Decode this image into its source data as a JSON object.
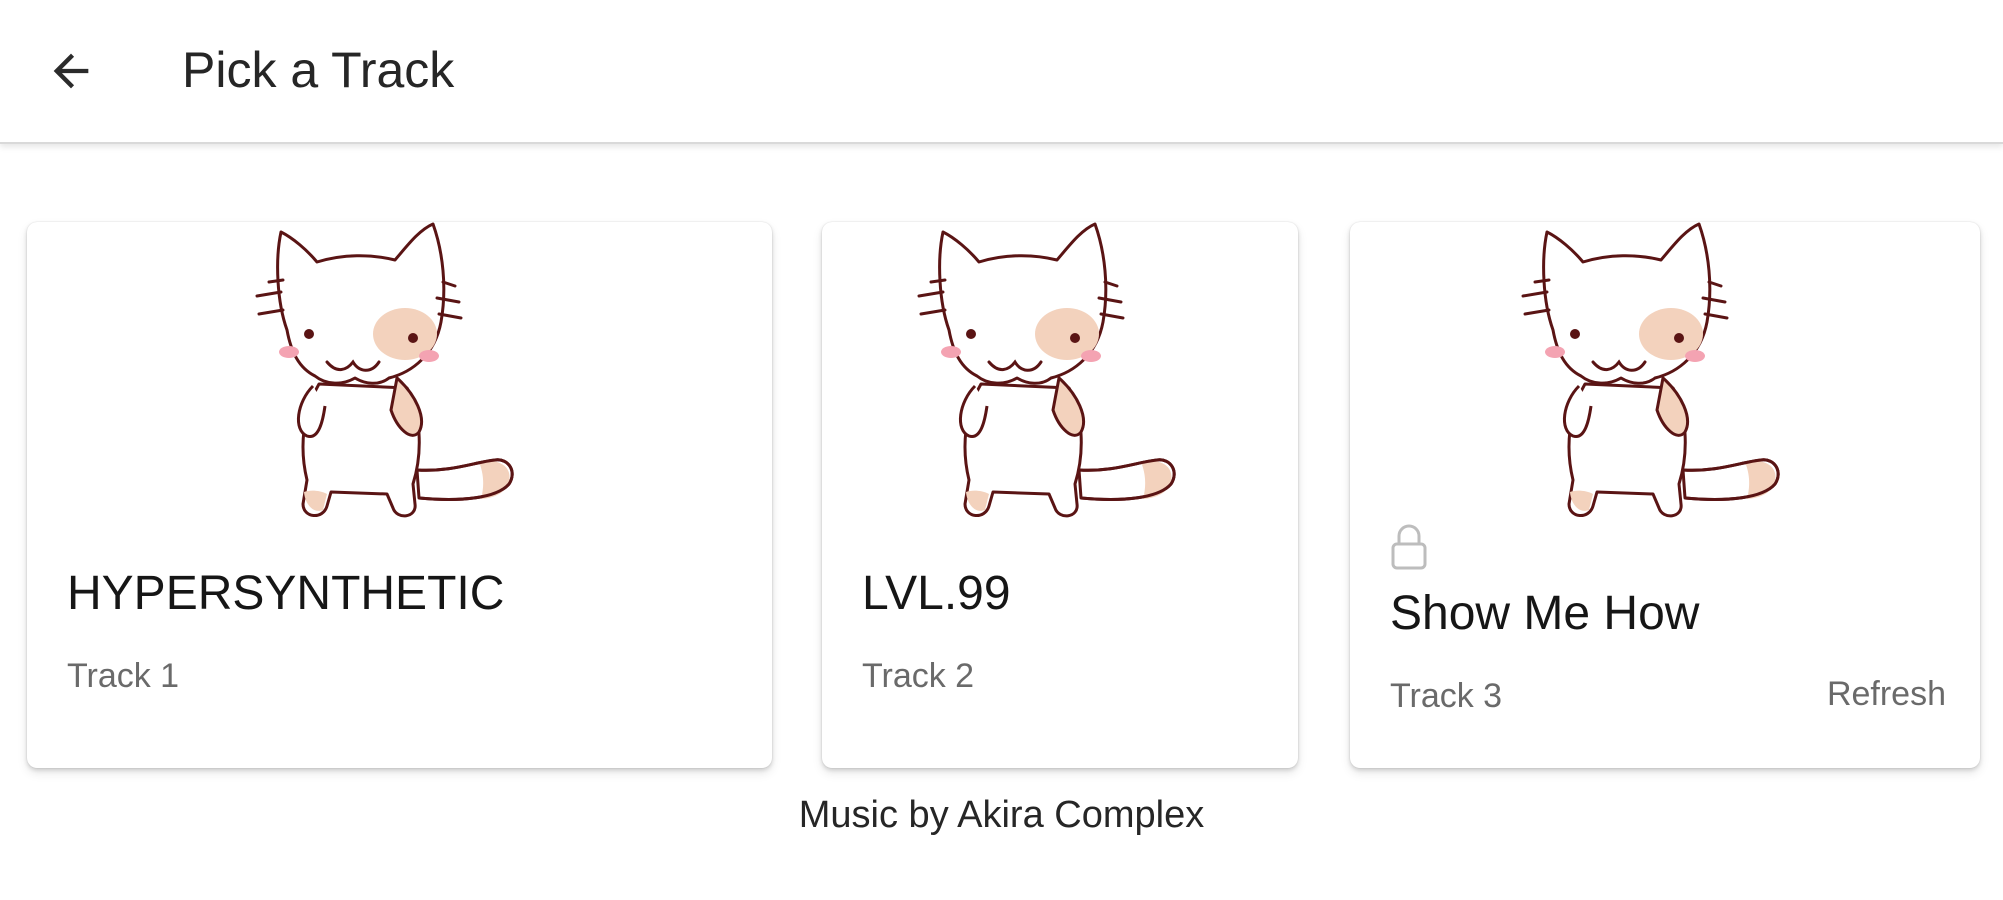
{
  "header": {
    "back_icon": "arrow-left-icon",
    "title": "Pick a Track"
  },
  "tracks": [
    {
      "title": "HYPERSYNTHETIC",
      "subtitle": "Track 1",
      "locked": false,
      "image": "cat-illustration"
    },
    {
      "title": "LVL.99",
      "subtitle": "Track 2",
      "locked": false,
      "image": "cat-illustration"
    },
    {
      "title": "Show Me How",
      "subtitle": "Track 3",
      "locked": true,
      "lock_icon": "lock-icon",
      "action_label": "Refresh",
      "image": "cat-illustration"
    }
  ],
  "footer": {
    "credits": "Music by Akira Complex"
  },
  "colors": {
    "outline": "#5a1414",
    "patch": "#f3d2bd",
    "blush": "#f4a3b2"
  }
}
